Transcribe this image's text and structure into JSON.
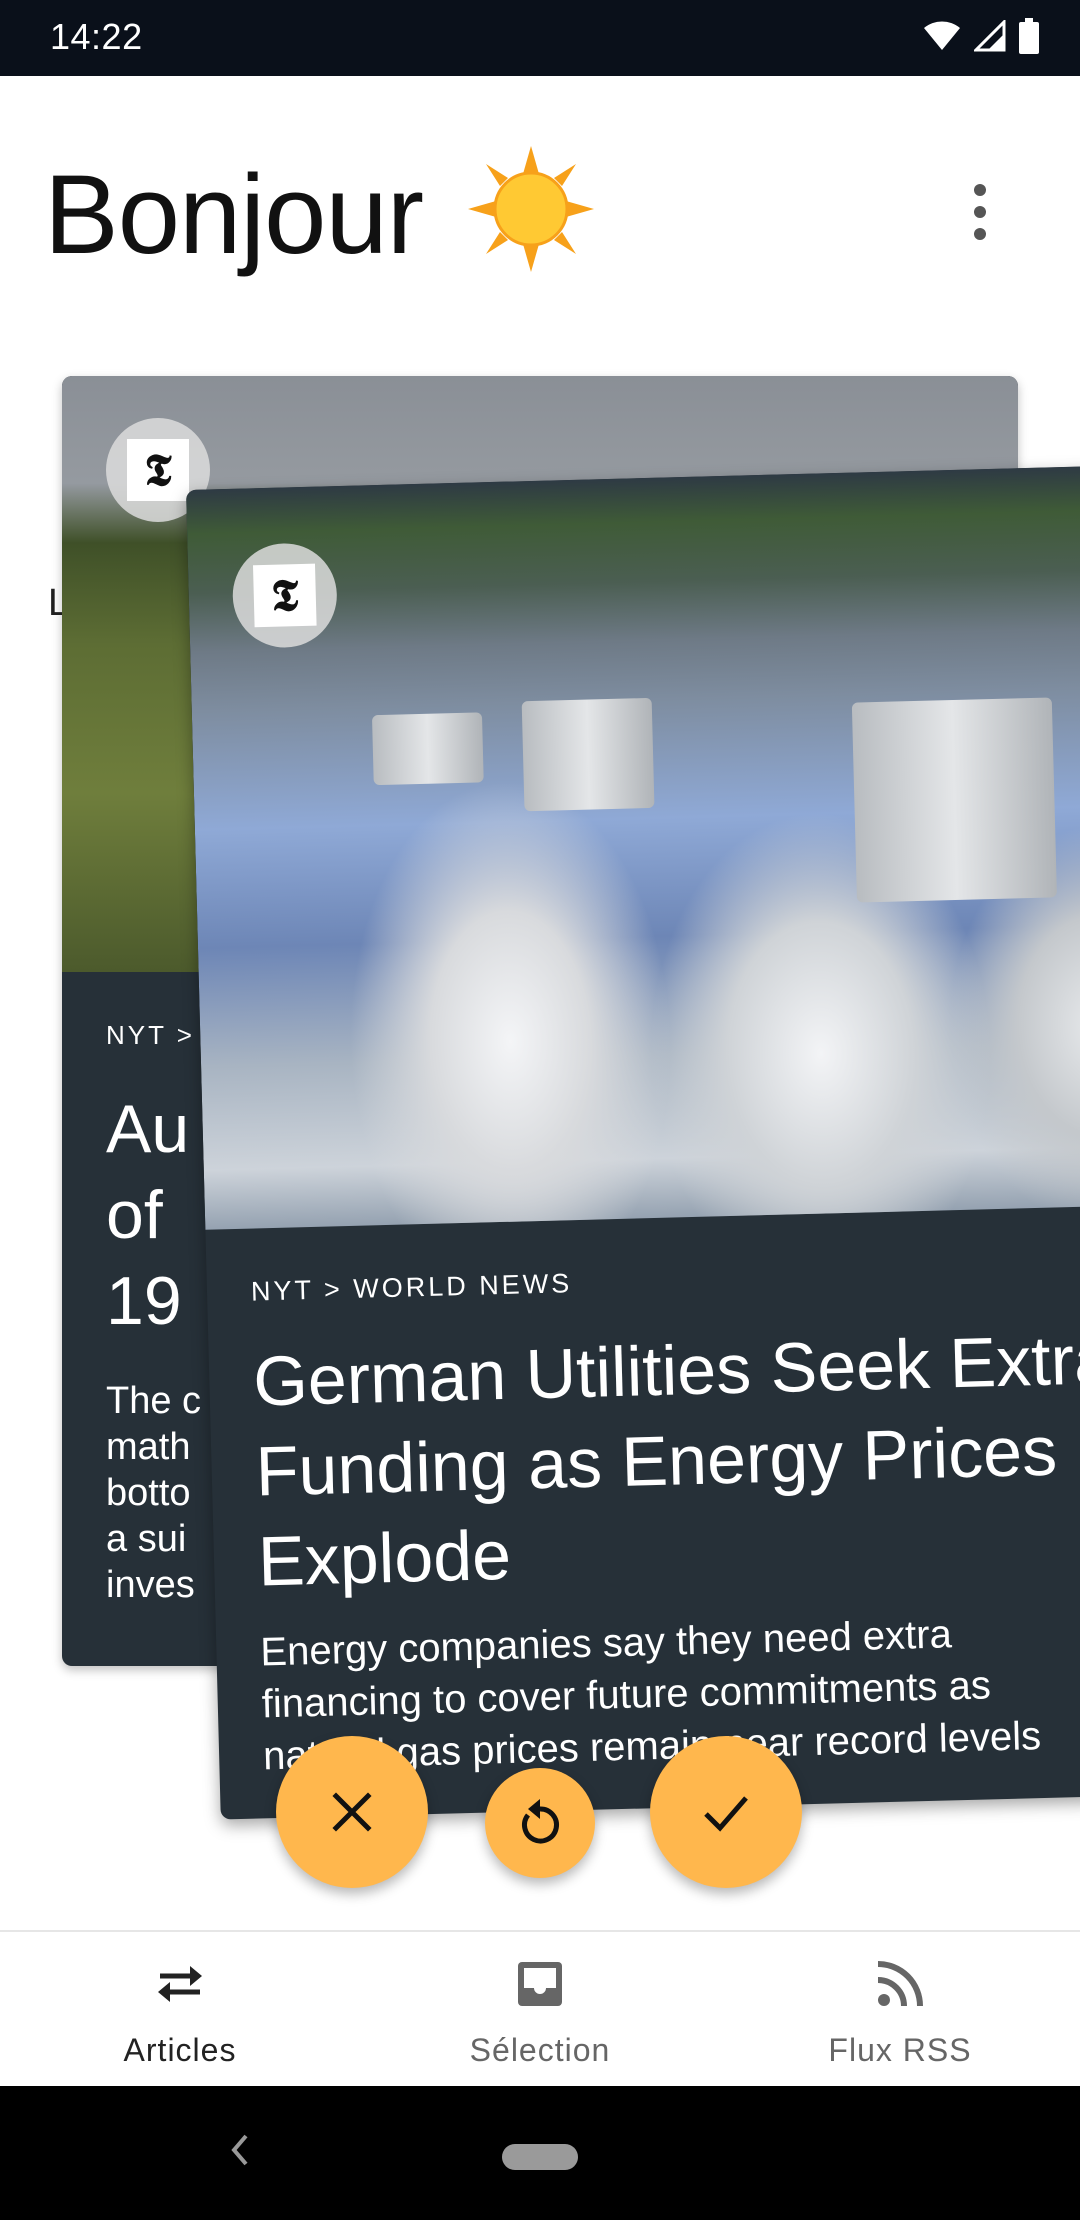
{
  "status_bar": {
    "time": "14:22"
  },
  "header": {
    "title": "Bonjour",
    "weather_icon": "sun-icon",
    "menu_icon": "more-vert-icon"
  },
  "cards": [
    {
      "position": "back",
      "source": "NYT >",
      "title_lines": [
        "Au",
        "of",
        "19"
      ],
      "description_lines": [
        "The c",
        "math",
        "botto",
        "a sui",
        "inves"
      ],
      "image_icon": "landscape-photo",
      "partial_letter": "L"
    },
    {
      "position": "front",
      "source": "NYT > WORLD NEWS",
      "title": "German Utilities Seek Extra Funding as Energy Prices Explode",
      "description_lines": [
        "Energy companies say they need extra",
        "financing to cover future commitments as",
        "natural gas prices remain near record levels"
      ],
      "image_icon": "cooling-towers-photo"
    }
  ],
  "actions": {
    "dismiss_icon": "close-icon",
    "undo_icon": "undo-icon",
    "accept_icon": "check-icon"
  },
  "bottom_nav": {
    "items": [
      {
        "label": "Articles",
        "icon": "swap-arrows-icon",
        "active": true
      },
      {
        "label": "Sélection",
        "icon": "inbox-icon",
        "active": false
      },
      {
        "label": "Flux RSS",
        "icon": "rss-icon",
        "active": false
      }
    ]
  },
  "colors": {
    "card_bg": "#263038",
    "fab": "#ffb74d",
    "status_bar": "#0a101a"
  }
}
